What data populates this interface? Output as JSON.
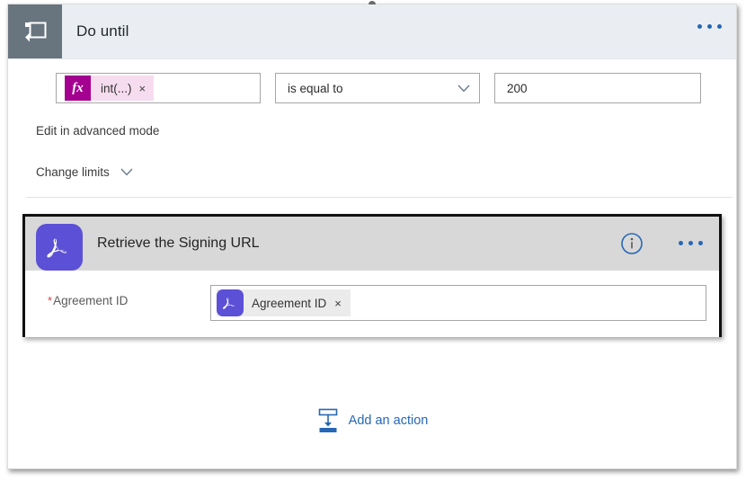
{
  "designer": {
    "loop_card": {
      "icon": "loop-repeat-icon",
      "title": "Do until",
      "more_menu": "ellipsis-icon",
      "condition": {
        "left_operand": {
          "fx_badge": "fx",
          "token_text": "int(...)",
          "remove": "×"
        },
        "operator": {
          "value": "is equal to",
          "chevron": "chevron-down-icon"
        },
        "right_operand": {
          "value": "200"
        }
      },
      "advanced_link": "Edit in advanced mode",
      "limits_link": "Change limits",
      "limits_chevron": "chevron-down-icon"
    },
    "action_card": {
      "icon": "adobe-acrobat-icon",
      "title": "Retrieve the Signing URL",
      "info": "info-icon",
      "more_menu": "ellipsis-icon",
      "field": {
        "required_marker": "*",
        "label": "Agreement ID",
        "token": {
          "icon": "adobe-acrobat-icon",
          "text": "Agreement ID",
          "remove": "×"
        }
      }
    },
    "add_action": {
      "icon": "insert-action-icon",
      "label": "Add an action"
    },
    "colors": {
      "loop_header_bg": "#eaeef2",
      "loop_icon_tile": "#68747e",
      "action_header_bg": "#d8d8d8",
      "acrobat_purple": "#5c50d6",
      "fx_magenta": "#a3008f",
      "fx_chip_pink": "#f6dcef",
      "accent_blue": "#2667b5",
      "required_red": "#d23f3f",
      "selection_border": "#111111"
    }
  }
}
